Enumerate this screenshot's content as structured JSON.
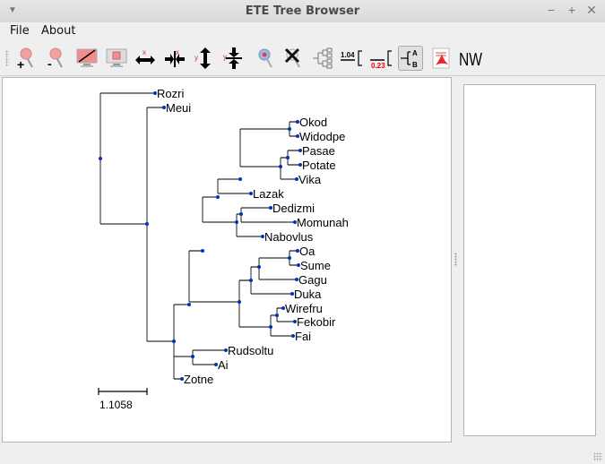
{
  "window": {
    "title": "ETE Tree Browser",
    "controls": [
      "minimize",
      "maximize",
      "close"
    ]
  },
  "menubar": {
    "items": [
      {
        "label": "File"
      },
      {
        "label": "About"
      }
    ]
  },
  "toolbar": {
    "buttons": [
      {
        "name": "zoom-in",
        "icon": "zoom-in-icon"
      },
      {
        "name": "zoom-out",
        "icon": "zoom-out-icon"
      },
      {
        "name": "fit-to-window",
        "icon": "fit-window-icon"
      },
      {
        "name": "fit-region",
        "icon": "fit-region-icon"
      },
      {
        "name": "expand-x",
        "icon": "expand-x-icon",
        "glyph": "x"
      },
      {
        "name": "shrink-x",
        "icon": "shrink-x-icon",
        "glyph": "x"
      },
      {
        "name": "expand-y",
        "icon": "expand-y-icon",
        "glyph": "y"
      },
      {
        "name": "shrink-y",
        "icon": "shrink-y-icon",
        "glyph": "y"
      },
      {
        "name": "search-node",
        "icon": "search-node-icon"
      },
      {
        "name": "clear-search",
        "icon": "clear-search-icon"
      },
      {
        "name": "force-topology",
        "icon": "topology-icon"
      },
      {
        "name": "show-branch-length",
        "icon": "branch-length-icon",
        "glyph": "1.04"
      },
      {
        "name": "show-branch-support",
        "icon": "branch-support-icon",
        "glyph": "0.23"
      },
      {
        "name": "show-leaf-names",
        "icon": "leaf-names-icon",
        "glyph_top": "A",
        "glyph_bottom": "B",
        "active": true
      },
      {
        "name": "export-pdf",
        "icon": "pdf-icon"
      },
      {
        "name": "show-newick",
        "icon": "newick-icon",
        "glyph": "NW"
      }
    ]
  },
  "tree": {
    "leaves": [
      "Rozri",
      "Meui",
      "Okod",
      "Widodpe",
      "Pasae",
      "Potate",
      "Vika",
      "Lazak",
      "Dedizmi",
      "Momunah",
      "Nabovlus",
      "Oa",
      "Sume",
      "Gagu",
      "Duka",
      "Wirefru",
      "Fekobir",
      "Fai",
      "Rudsoltu",
      "Ai",
      "Zotne"
    ],
    "newick": "(Rozri,(Meui,(((((Okod,Widodpe),((Pasae,Potate),Vika)),Lazak),((Dedizmi,Momunah),Nabovlus)),((((Oa,Sume),Gagu),Duka),((Wirefru,Fekobir),Fai))),(Rudsoltu,Ai)),Zotne)));",
    "scale_label": "1.1058",
    "colors": {
      "branch": "#000000",
      "node": "#0030c0",
      "label": "#000000"
    }
  },
  "side_panel": {
    "content": ""
  }
}
